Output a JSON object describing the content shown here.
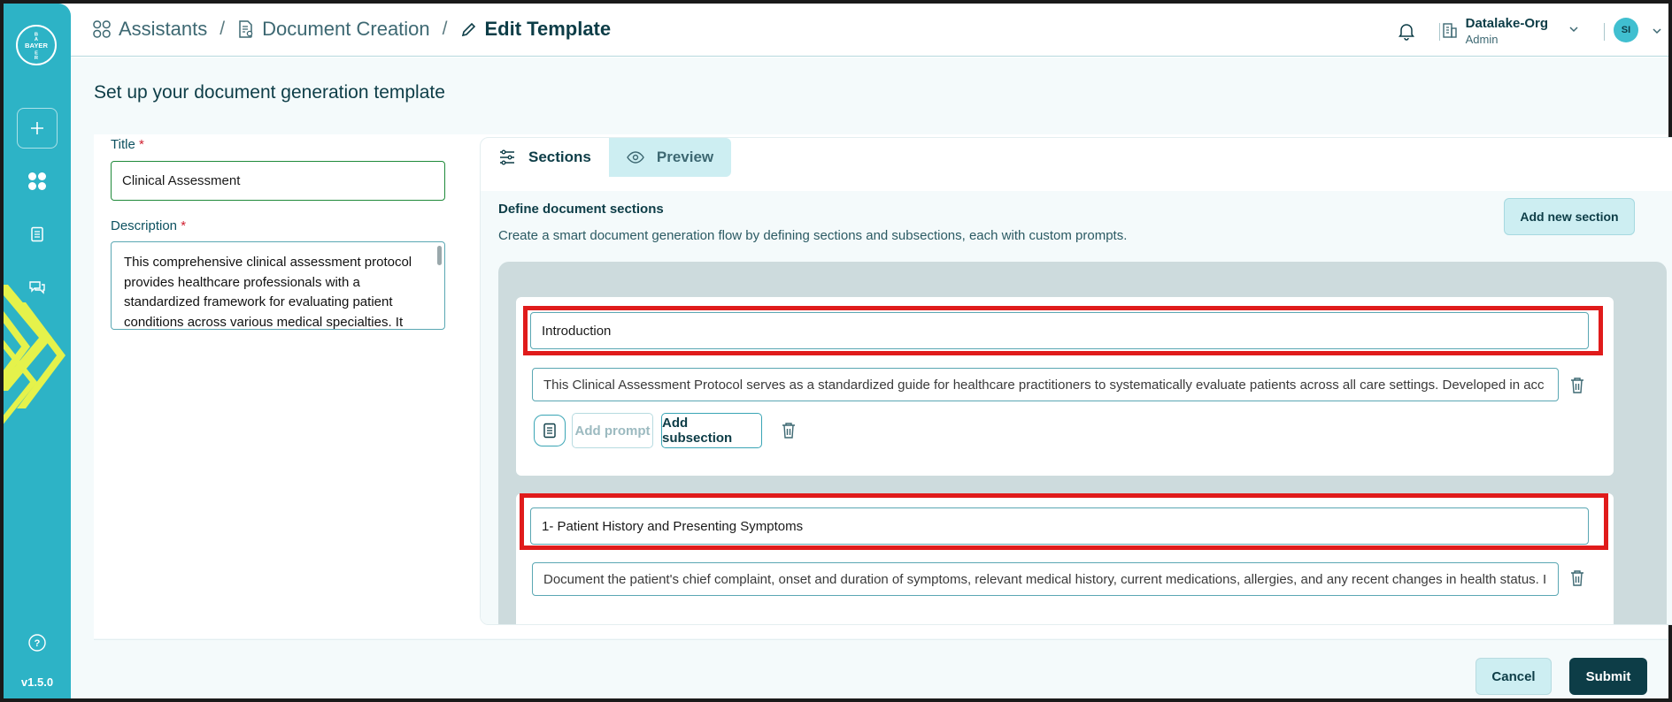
{
  "sidebar": {
    "logo_text": "BAYER",
    "version": "v1.5.0",
    "icons": [
      "plus-icon",
      "apps-icon",
      "document-icon",
      "chat-icon",
      "help-icon"
    ]
  },
  "header": {
    "breadcrumbs": [
      {
        "label": "Assistants",
        "icon": "apps-icon"
      },
      {
        "label": "Document Creation",
        "icon": "document-icon"
      },
      {
        "label": "Edit Template",
        "icon": "pencil-icon"
      }
    ],
    "separator": "/",
    "org": {
      "name": "Datalake-Org",
      "role": "Admin"
    },
    "avatar_initials": "SI"
  },
  "page": {
    "title": "Set up your document generation template"
  },
  "form": {
    "title_label": "Title",
    "title_value": "Clinical Assessment",
    "description_label": "Description",
    "required_mark": "*",
    "description_value": "This comprehensive clinical assessment protocol provides healthcare professionals with a standardized framework for evaluating patient conditions across various medical specialties. It"
  },
  "tabs": {
    "sections": "Sections",
    "preview": "Preview"
  },
  "sections_panel": {
    "heading": "Define document sections",
    "subtitle": "Create a smart document generation flow by defining sections and subsections, each with custom prompts.",
    "add_section": "Add new section",
    "sections": [
      {
        "name": "Introduction",
        "prompt": "This Clinical Assessment Protocol serves as a standardized guide for healthcare practitioners to systematically evaluate patients across all care settings. Developed in acc"
      },
      {
        "name": "1- Patient History and Presenting Symptoms",
        "prompt": "Document the patient's chief complaint, onset and duration of symptoms, relevant medical history, current medications, allergies, and any recent changes in health status. I"
      }
    ],
    "add_prompt": "Add prompt",
    "add_subsection": "Add subsection"
  },
  "footer": {
    "cancel": "Cancel",
    "submit": "Submit"
  },
  "colors": {
    "sidebar": "#2db3c6",
    "primary_dark": "#0d3d47",
    "accent_light": "#cdeef2",
    "highlight_red": "#e01b1b",
    "required_red": "#d01f2f"
  }
}
